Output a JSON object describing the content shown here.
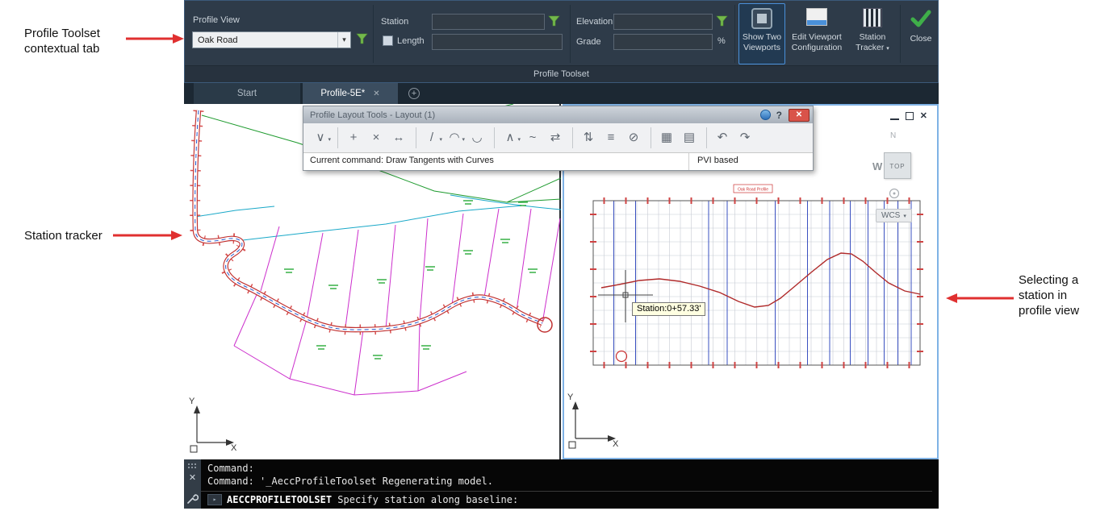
{
  "annotations": {
    "profile_toolset": {
      "line1": "Profile Toolset",
      "line2": "contextual tab"
    },
    "station_tracker": "Station tracker",
    "selecting_station": {
      "line1": "Selecting a",
      "line2": "station in",
      "line3": "profile view"
    }
  },
  "ribbon": {
    "profile_view": {
      "label": "Profile View",
      "value": "Oak Road"
    },
    "station": {
      "label": "Station",
      "value": ""
    },
    "length": {
      "label": "Length",
      "value": ""
    },
    "elevation": {
      "label": "Elevation",
      "value": ""
    },
    "grade": {
      "label": "Grade",
      "value": "",
      "suffix": "%"
    },
    "buttons": {
      "show_two_viewports": {
        "line1": "Show Two",
        "line2": "Viewports"
      },
      "edit_viewport_configuration": {
        "line1": "Edit Viewport",
        "line2": "Configuration"
      },
      "station_tracker": {
        "line1": "Station",
        "line2": "Tracker"
      },
      "close": "Close"
    },
    "panel_label": "Profile Toolset"
  },
  "tabs": {
    "start": "Start",
    "active": "Profile-5E*"
  },
  "palette": {
    "title": "Profile Layout Tools - Layout (1)",
    "status_left": "Current command: Draw Tangents with Curves",
    "status_right": "PVI based",
    "tools": [
      {
        "name": "draw-tangents",
        "glyph": "∨",
        "flyout": true
      },
      {
        "sep": true
      },
      {
        "name": "insert-pvi",
        "glyph": "+"
      },
      {
        "name": "delete-pvi",
        "glyph": "×"
      },
      {
        "name": "move-pvi",
        "glyph": "↔"
      },
      {
        "sep": true
      },
      {
        "name": "draw-fixed-tangent",
        "glyph": "/",
        "flyout": true
      },
      {
        "name": "draw-fixed-curve",
        "glyph": "◠",
        "flyout": true
      },
      {
        "name": "draw-free-curve",
        "glyph": "◡"
      },
      {
        "sep": true
      },
      {
        "name": "fixed-vertical-curve",
        "glyph": "∧",
        "flyout": true
      },
      {
        "name": "float-vertical-curve",
        "glyph": "~"
      },
      {
        "name": "convert-entities",
        "glyph": "⇄"
      },
      {
        "sep": true
      },
      {
        "name": "raise-lower-pvis",
        "glyph": "⇅"
      },
      {
        "name": "copy-profile",
        "glyph": "≡"
      },
      {
        "name": "delete-entity",
        "glyph": "⊘"
      },
      {
        "sep": true
      },
      {
        "name": "profile-grid-view",
        "glyph": "▦"
      },
      {
        "name": "profile-layout-parameters",
        "glyph": "▤"
      },
      {
        "sep": true
      },
      {
        "name": "undo",
        "glyph": "↶"
      },
      {
        "name": "redo",
        "glyph": "↷"
      }
    ]
  },
  "profile_view": {
    "tooltip": "Station:0+57.33'",
    "title": "Oak Road Profile",
    "viewcube": {
      "top": "TOP",
      "west": "W",
      "north": "N"
    },
    "wcs": "WCS"
  },
  "ucs": {
    "x": "X",
    "y": "Y"
  },
  "command_line": {
    "line1": "Command:",
    "line2": "Command: '_AeccProfileToolset Regenerating model.",
    "prompt_bold": "AECCPROFILETOOLSET",
    "prompt_rest": " Specify station along baseline:"
  },
  "glyphs": {
    "caret_down": "▾",
    "close_x": "✕",
    "plus": "+",
    "question": "?",
    "play": "▸"
  },
  "colors": {
    "highlight": "#4a90d9",
    "annotation_arrow": "#e03030",
    "profile_line": "#b02a2a"
  }
}
